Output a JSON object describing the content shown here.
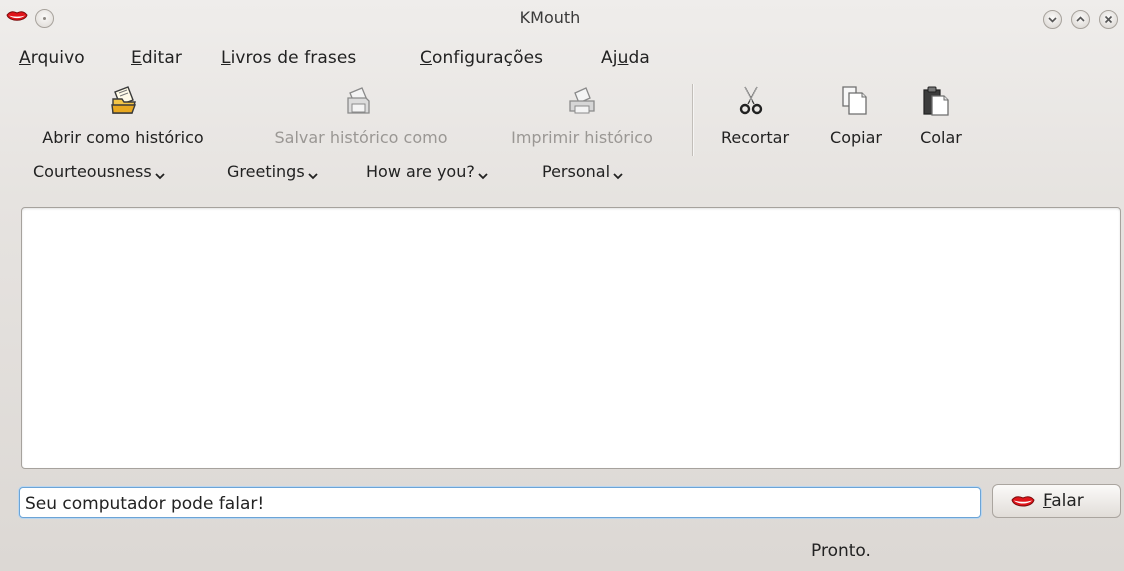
{
  "window": {
    "title": "KMouth",
    "app_icon": "lips-icon",
    "accent_lips": "#e0141a"
  },
  "menubar": {
    "items": [
      {
        "pre": "",
        "key": "A",
        "post": "rquivo"
      },
      {
        "pre": "",
        "key": "E",
        "post": "ditar"
      },
      {
        "pre": "",
        "key": "L",
        "post": "ivros de frases"
      },
      {
        "pre": "",
        "key": "C",
        "post": "onfigurações"
      },
      {
        "pre": "Aj",
        "key": "u",
        "post": "da"
      }
    ]
  },
  "toolbar": {
    "items": [
      {
        "label": "Abrir como histórico",
        "icon": "open-history-icon",
        "enabled": true
      },
      {
        "label": "Salvar histórico como",
        "icon": "save-history-icon",
        "enabled": false
      },
      {
        "label": "Imprimir histórico",
        "icon": "print-history-icon",
        "enabled": false
      },
      {
        "label": "Recortar",
        "icon": "scissors-icon",
        "enabled": true
      },
      {
        "label": "Copiar",
        "icon": "copy-icon",
        "enabled": true
      },
      {
        "label": "Colar",
        "icon": "paste-icon",
        "enabled": true
      }
    ]
  },
  "phrasebooks": {
    "items": [
      {
        "label": "Courteousness"
      },
      {
        "label": "Greetings"
      },
      {
        "label": "How are you?"
      },
      {
        "label": "Personal"
      }
    ]
  },
  "history": {
    "lines": []
  },
  "input": {
    "value": "Seu computador pode falar!",
    "placeholder": ""
  },
  "speak": {
    "label": "Falar",
    "icon": "lips-icon"
  },
  "status": {
    "text": "Pronto."
  }
}
